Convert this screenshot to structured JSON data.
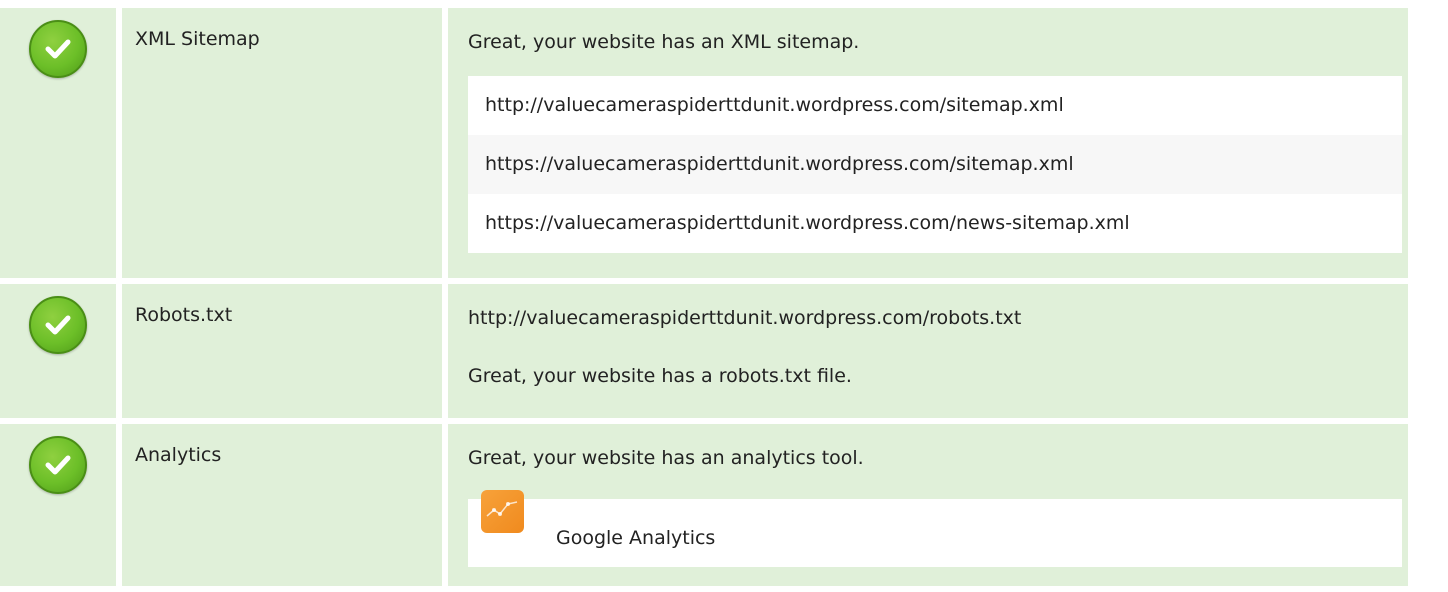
{
  "rows": [
    {
      "status": "passed",
      "label": "XML Sitemap",
      "message": "Great, your website has an XML sitemap.",
      "sitemaps": [
        "http://valuecameraspiderttdunit.wordpress.com/sitemap.xml",
        "https://valuecameraspiderttdunit.wordpress.com/sitemap.xml",
        "https://valuecameraspiderttdunit.wordpress.com/news-sitemap.xml"
      ]
    },
    {
      "status": "passed",
      "label": "Robots.txt",
      "url": "http://valuecameraspiderttdunit.wordpress.com/robots.txt",
      "message": "Great, your website has a robots.txt file."
    },
    {
      "status": "passed",
      "label": "Analytics",
      "message": "Great, your website has an analytics tool.",
      "tool": {
        "name": "Google Analytics",
        "icon": "google-analytics-icon"
      }
    }
  ],
  "colors": {
    "row_background": "#e0f0d9",
    "check_green": "#6cbf28",
    "analytics_orange": "#f39a2c"
  }
}
